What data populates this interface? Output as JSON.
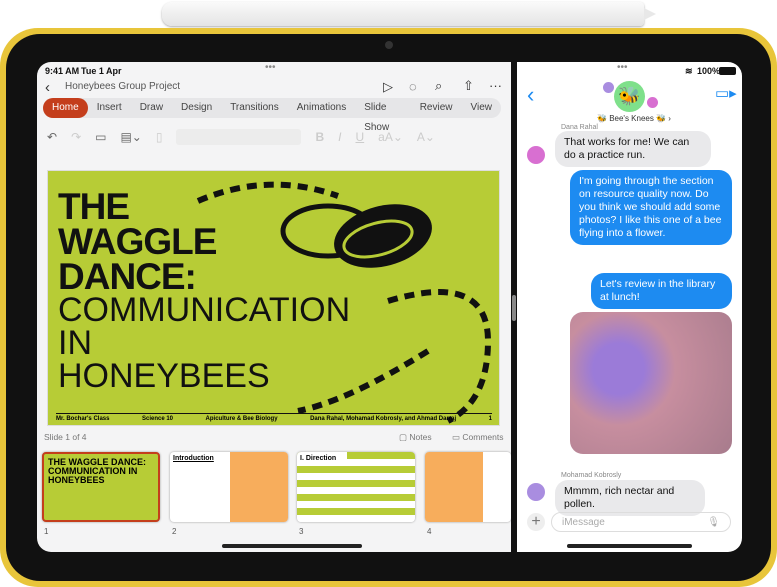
{
  "status": {
    "time": "9:41 AM",
    "date": "Tue 1 Apr",
    "battery": "100%"
  },
  "ppt": {
    "doc_title": "Honeybees Group Project",
    "tabs": [
      "Home",
      "Insert",
      "Draw",
      "Design",
      "Transitions",
      "Animations",
      "Slide Show",
      "Review",
      "View"
    ],
    "slide": {
      "title_bold": [
        "THE",
        "WAGGLE",
        "DANCE:"
      ],
      "title_thin": [
        "COMMUNICATION",
        "IN",
        "HONEYBEES"
      ],
      "footer": [
        "Mr. Bochar's Class",
        "Science 10",
        "Apiculture & Bee Biology",
        "Dana Rahal, Mohamad Kobrosly, and Ahmad Darraj",
        "1"
      ]
    },
    "slide_counter": "Slide 1 of 4",
    "notes": "Notes",
    "comments": "Comments",
    "thumbs": [
      {
        "num": "1",
        "title": "THE WAGGLE DANCE: COMMUNICATION IN HONEYBEES"
      },
      {
        "num": "2",
        "title": "Introduction"
      },
      {
        "num": "3",
        "title": "I. Direction"
      },
      {
        "num": "4",
        "title": ""
      }
    ],
    "accent": "#c43e1c",
    "slide_color": "#b7cc36"
  },
  "messages": {
    "group_name": "Bee's Knees",
    "accent": "#1d8bf1",
    "items": [
      {
        "sender": "Dana Rahal",
        "text": "That works for me! We can do a practice run."
      },
      {
        "text": "I'm going through the section on resource quality now. Do you think we should add some photos? I like this one of a bee flying into a flower."
      },
      {
        "text": "Let's review in the library at lunch!"
      },
      {
        "sender": "Mohamad Kobrosly",
        "text": "Mmmm, rich nectar and pollen."
      }
    ],
    "input_placeholder": "iMessage"
  }
}
